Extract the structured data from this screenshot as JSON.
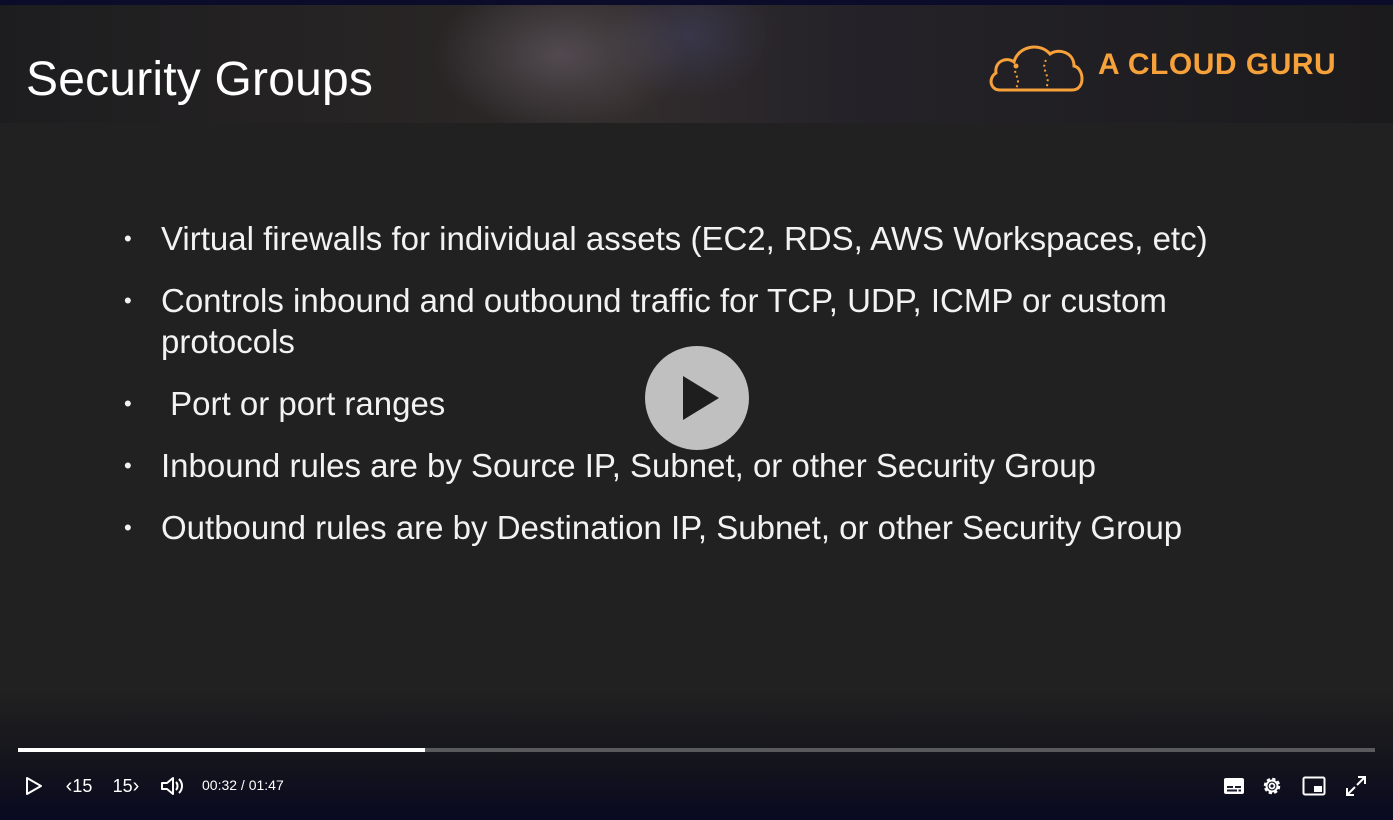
{
  "slide": {
    "title": "Security Groups",
    "brand": "A CLOUD GURU",
    "bullets": [
      "Virtual firewalls for individual assets (EC2, RDS, AWS Workspaces, etc)",
      "Controls inbound and outbound traffic for TCP, UDP, ICMP or custom protocols",
      " Port or port ranges",
      "Inbound rules are by Source IP, Subnet, or other Security Group",
      "Outbound rules are by Destination IP, Subnet, or other Security Group"
    ],
    "bullet_glyph": "•"
  },
  "player": {
    "progress_fraction": 0.3,
    "rewind_label": "15",
    "forward_label": "15",
    "current_time": "00:32",
    "separator": " / ",
    "duration": "01:47",
    "icons": [
      "play-icon",
      "rewind-15-icon",
      "forward-15-icon",
      "volume-icon",
      "captions-icon",
      "settings-icon",
      "picture-in-picture-icon",
      "fullscreen-icon"
    ]
  },
  "colors": {
    "brand": "#f6a13a",
    "slide_bg": "#212121",
    "text": "#f2f2f2"
  }
}
